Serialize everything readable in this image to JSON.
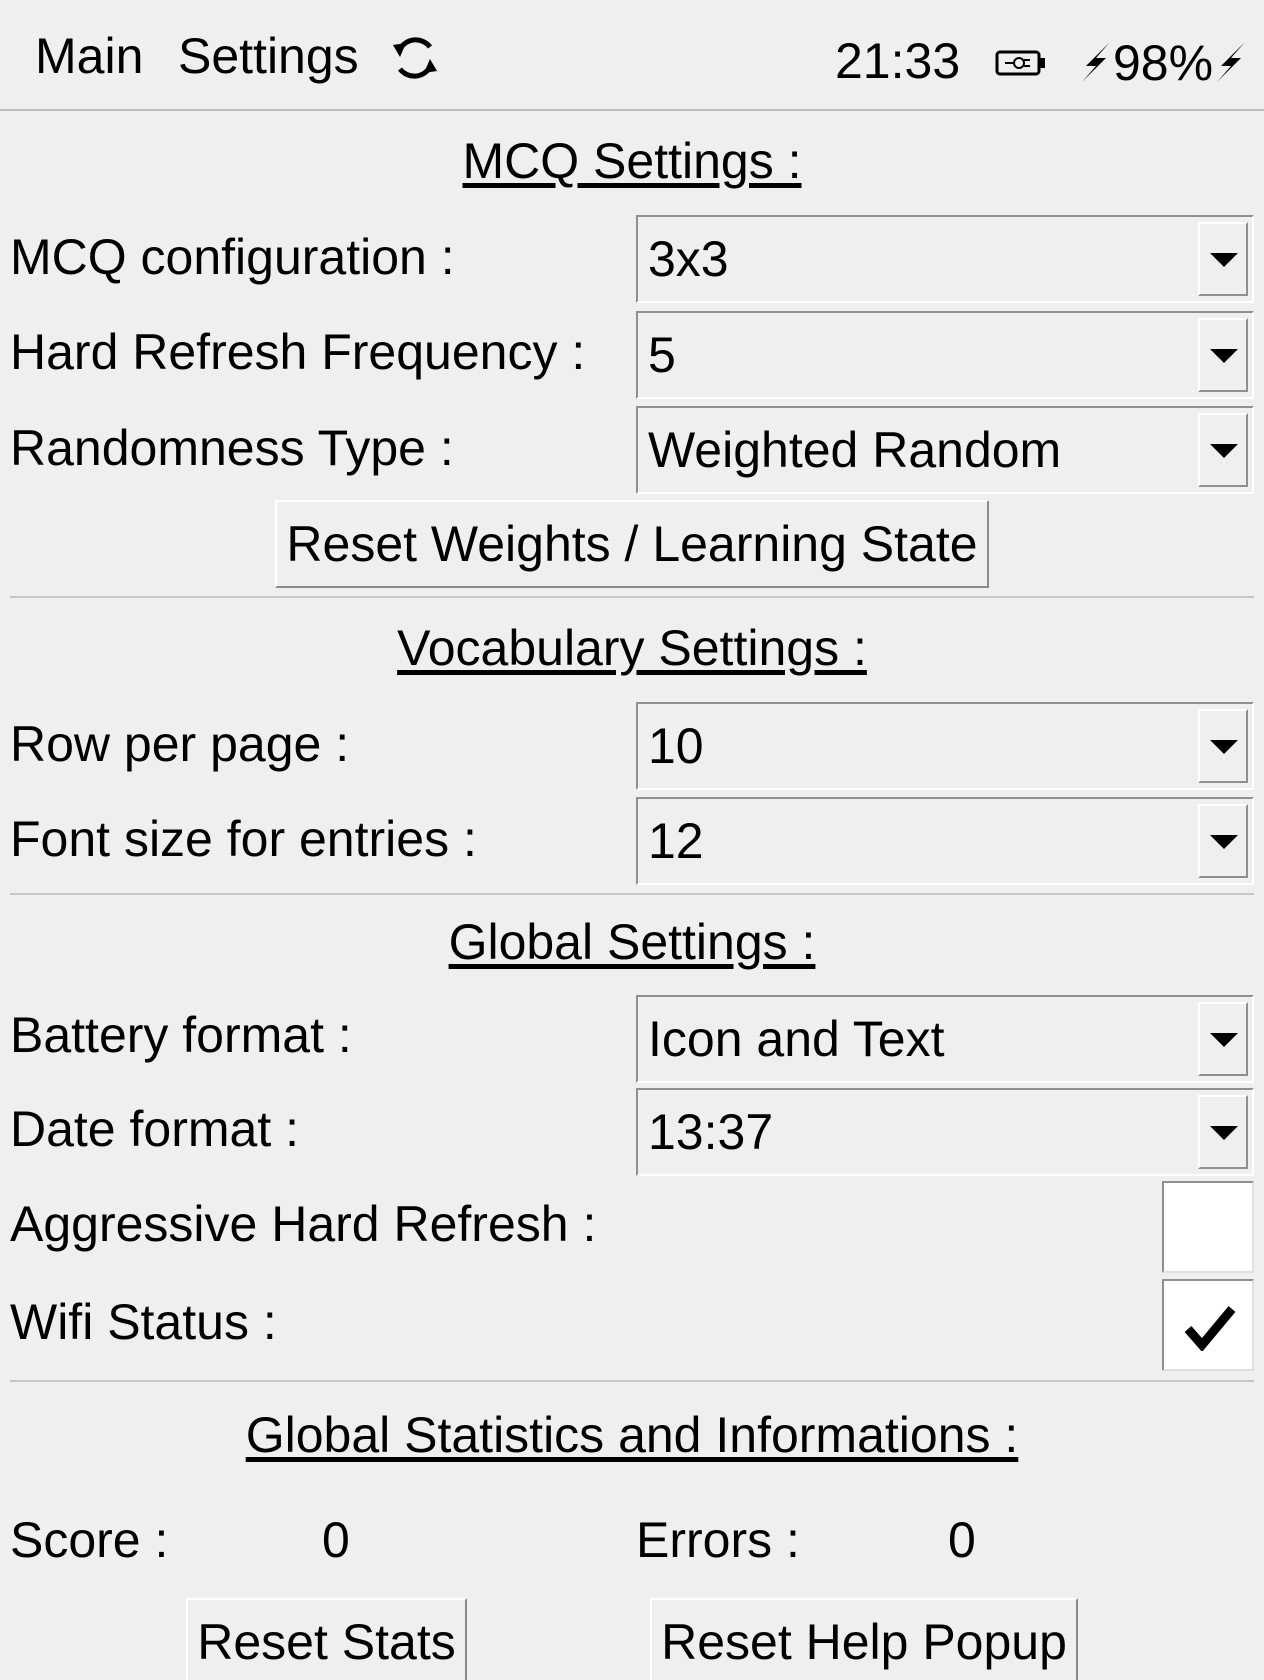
{
  "topbar": {
    "tab_main": "Main",
    "tab_settings": "Settings",
    "time": "21:33",
    "battery_percent": "98%",
    "icons": [
      "refresh-icon",
      "battery-icon",
      "charging-bolt-icon"
    ]
  },
  "mcq": {
    "title": "MCQ Settings :",
    "configuration_label": "MCQ configuration :",
    "configuration_value": "3x3",
    "hard_refresh_label": "Hard Refresh Frequency :",
    "hard_refresh_value": "5",
    "randomness_label": "Randomness Type :",
    "randomness_value": "Weighted Random",
    "reset_weights_button": "Reset Weights / Learning State"
  },
  "vocabulary": {
    "title": "Vocabulary Settings :",
    "rows_label": "Row per page :",
    "rows_value": "10",
    "font_size_label": "Font size for entries :",
    "font_size_value": "12"
  },
  "global": {
    "title": "Global Settings :",
    "battery_format_label": "Battery format :",
    "battery_format_value": "Icon and Text",
    "date_format_label": "Date format :",
    "date_format_value": "13:37",
    "aggressive_refresh_label": "Aggressive Hard Refresh :",
    "aggressive_refresh_checked": false,
    "wifi_status_label": "Wifi Status :",
    "wifi_status_checked": true
  },
  "stats": {
    "title": "Global Statistics and Informations :",
    "score_label": "Score :",
    "score_value": "0",
    "errors_label": "Errors :",
    "errors_value": "0",
    "reset_stats_button": "Reset Stats",
    "reset_help_button": "Reset Help Popup"
  }
}
